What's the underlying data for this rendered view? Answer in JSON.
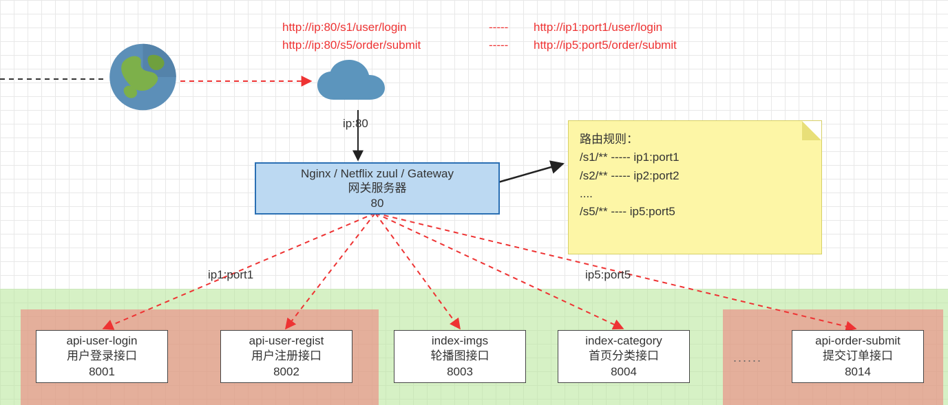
{
  "mappings": {
    "row1_left": "http://ip:80/s1/user/login",
    "row1_dash": "-----",
    "row1_right": "http://ip1:port1/user/login",
    "row2_left": "http://ip:80/s5/order/submit",
    "row2_dash": "-----",
    "row2_right": "http://ip5:port5/order/submit"
  },
  "cloud_label": "ip:80",
  "gateway": {
    "line1": "Nginx / Netflix zuul / Gateway",
    "line2": "网关服务器",
    "line3": "80"
  },
  "note": {
    "title": "路由规则：",
    "r1": "/s1/** ----- ip1:port1",
    "r2": "/s2/** ----- ip2:port2",
    "r3": "....",
    "r4": "/s5/** ---- ip5:port5"
  },
  "labels": {
    "ip1": "ip1:port1",
    "ip5": "ip5:port5"
  },
  "services": {
    "s1": {
      "name": "api-user-login",
      "desc": "用户登录接口",
      "port": "8001"
    },
    "s2": {
      "name": "api-user-regist",
      "desc": "用户注册接口",
      "port": "8002"
    },
    "s3": {
      "name": "index-imgs",
      "desc": "轮播图接口",
      "port": "8003"
    },
    "s4": {
      "name": "index-category",
      "desc": "首页分类接口",
      "port": "8004"
    },
    "s5": {
      "name": "api-order-submit",
      "desc": "提交订单接口",
      "port": "8014"
    }
  },
  "ellipsis": "......"
}
